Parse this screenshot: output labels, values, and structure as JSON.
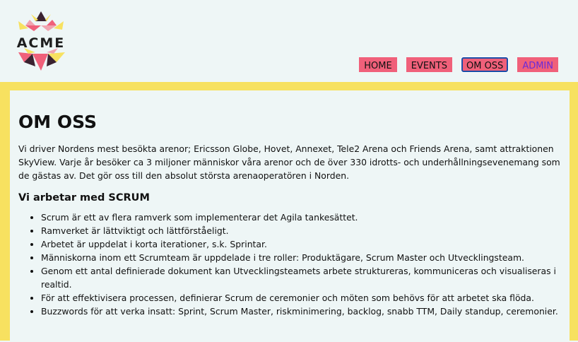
{
  "logo": {
    "text": "ACME"
  },
  "nav": {
    "items": [
      {
        "label": "HOME"
      },
      {
        "label": "EVENTS"
      },
      {
        "label": "OM OSS"
      },
      {
        "label": "ADMIN"
      }
    ]
  },
  "main": {
    "title": "OM OSS",
    "intro": "Vi driver Nordens mest besökta arenor; Ericsson Globe, Hovet, Annexet, Tele2 Arena och Friends Arena, samt attraktionen SkyView. Varje år besöker ca 3 miljoner människor våra arenor och de över 330 idrotts- och underhållningsevenemang som de gästas av. Det gör oss till den absolut största arenaoperatören i Norden.",
    "subtitle": "Vi arbetar med SCRUM",
    "list": [
      "Scrum är ett av flera ramverk som implementerar det Agila tankesättet.",
      "Ramverket är lättviktigt och lättförståeligt.",
      "Arbetet är uppdelat i korta iterationer, s.k. Sprintar.",
      "Människorna inom ett Scrumteam är uppdelade i tre roller: Produktägare, Scrum Master och Utvecklingsteam.",
      "Genom ett antal definierade dokument kan Utvecklingsteamets arbete struktureras, kommuniceras och visualiseras i realtid.",
      "För att effektivisera processen, definierar Scrum de ceremonier och möten som behövs för att arbetet ska flöda.",
      "Buzzwords för att verka insatt: Sprint, Scrum Master, riskminimering, backlog, snabb TTM, Daily standup, ceremonier."
    ]
  },
  "colors": {
    "nav_bg": "#f0607a",
    "frame": "#f7e160",
    "page_bg": "#eef6f6",
    "active_border": "#1c4fa8",
    "admin_text": "#6a2bd8"
  }
}
